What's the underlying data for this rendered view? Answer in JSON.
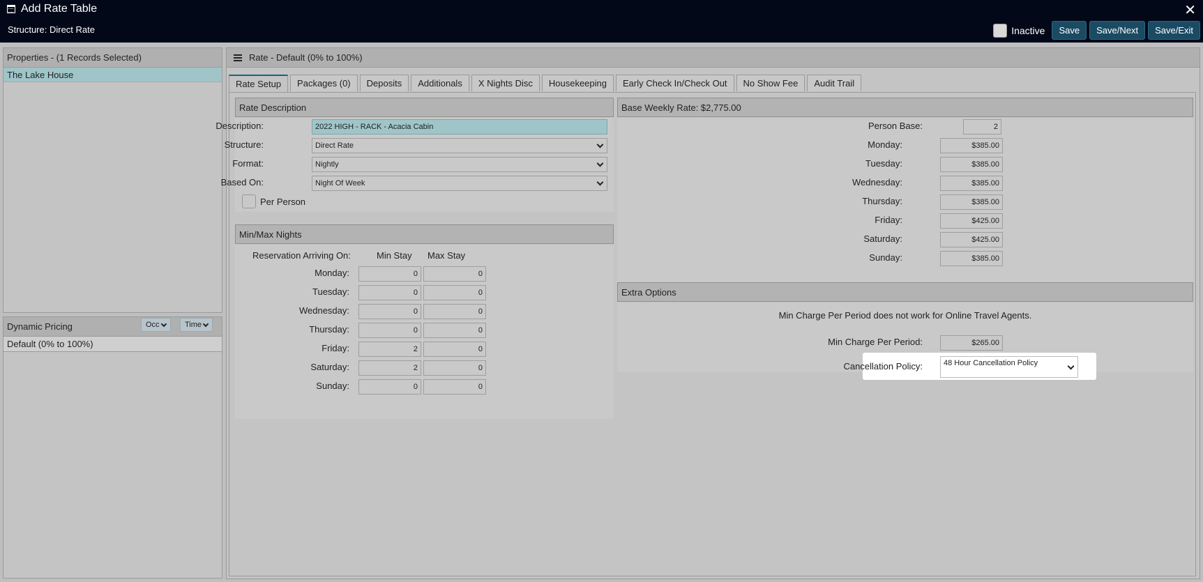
{
  "header": {
    "title": "Add Rate Table",
    "subtitle": "Structure: Direct Rate",
    "inactive_label": "Inactive",
    "buttons": {
      "save": "Save",
      "save_next": "Save/Next",
      "save_exit": "Save/Exit"
    },
    "close_glyph": "✕"
  },
  "properties": {
    "heading": "Properties - (1 Records Selected)",
    "items": [
      "The Lake House"
    ]
  },
  "dynamic_pricing": {
    "heading": "Dynamic Pricing",
    "occ_label": "Occ",
    "time_label": "Time",
    "items": [
      "Default (0% to 100%)"
    ]
  },
  "main": {
    "heading": "Rate - Default (0% to 100%)",
    "tabs": [
      "Rate Setup",
      "Packages (0)",
      "Deposits",
      "Additionals",
      "X Nights Disc",
      "Housekeeping",
      "Early Check In/Check Out",
      "No Show Fee",
      "Audit Trail"
    ]
  },
  "rate_description": {
    "heading": "Rate Description",
    "description_label": "Description:",
    "description_value": "2022 HIGH - RACK - Acacia Cabin",
    "structure_label": "Structure:",
    "structure_value": "Direct Rate",
    "format_label": "Format:",
    "format_value": "Nightly",
    "based_on_label": "Based On:",
    "based_on_value": "Night Of Week",
    "per_person_label": "Per Person"
  },
  "min_max": {
    "heading": "Min/Max Nights",
    "arriving_label": "Reservation Arriving On:",
    "min_header": "Min Stay",
    "max_header": "Max Stay",
    "rows": [
      {
        "day": "Monday:",
        "min": "0",
        "max": "0"
      },
      {
        "day": "Tuesday:",
        "min": "0",
        "max": "0"
      },
      {
        "day": "Wednesday:",
        "min": "0",
        "max": "0"
      },
      {
        "day": "Thursday:",
        "min": "0",
        "max": "0"
      },
      {
        "day": "Friday:",
        "min": "2",
        "max": "0"
      },
      {
        "day": "Saturday:",
        "min": "2",
        "max": "0"
      },
      {
        "day": "Sunday:",
        "min": "0",
        "max": "0"
      }
    ]
  },
  "base_weekly": {
    "heading": "Base Weekly Rate: $2,775.00",
    "person_base_label": "Person Base:",
    "person_base_value": "2",
    "rows": [
      {
        "day": "Monday:",
        "rate": "$385.00"
      },
      {
        "day": "Tuesday:",
        "rate": "$385.00"
      },
      {
        "day": "Wednesday:",
        "rate": "$385.00"
      },
      {
        "day": "Thursday:",
        "rate": "$385.00"
      },
      {
        "day": "Friday:",
        "rate": "$425.00"
      },
      {
        "day": "Saturday:",
        "rate": "$425.00"
      },
      {
        "day": "Sunday:",
        "rate": "$385.00"
      }
    ]
  },
  "extra_options": {
    "heading": "Extra Options",
    "note": "Min Charge Per Period does not work for Online Travel Agents.",
    "min_charge_label": "Min Charge Per Period:",
    "min_charge_value": "$265.00",
    "cancellation_label": "Cancellation Policy:",
    "cancellation_value": "48 Hour Cancellation Policy"
  }
}
